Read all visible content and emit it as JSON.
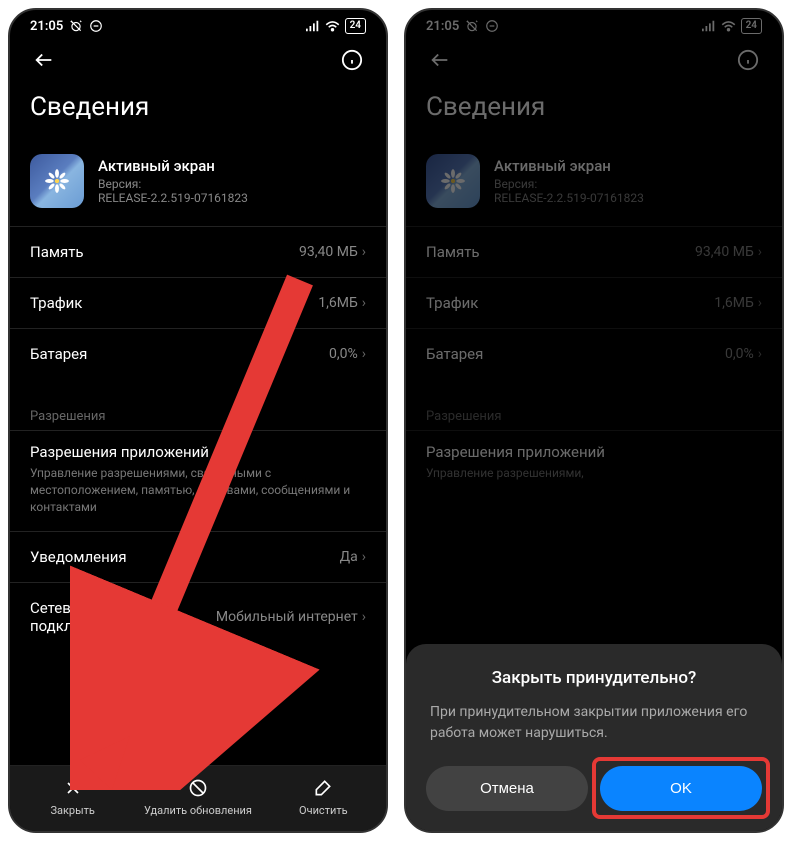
{
  "status": {
    "time": "21:05",
    "battery": "24"
  },
  "pageTitle": "Сведения",
  "app": {
    "name": "Активный экран",
    "versionLabel": "Версия:",
    "version": "RELEASE-2.2.519-07161823"
  },
  "items": {
    "memory": {
      "label": "Память",
      "value": "93,40 МБ"
    },
    "traffic": {
      "label": "Трафик",
      "value": "1,6МБ"
    },
    "battery": {
      "label": "Батарея",
      "value": "0,0%"
    }
  },
  "permissionsSection": "Разрешения",
  "permissions": {
    "title": "Разрешения приложений",
    "desc": "Управление разрешениями, связанными с местоположением, памятью, вызовами, сообщениями и контактами"
  },
  "permissionsShort": {
    "title": "Разрешения приложений",
    "desc": "Управление разрешениями,"
  },
  "notifications": {
    "label": "Уведомления",
    "value": "Да"
  },
  "network": {
    "label": "Сетевые подключения",
    "value": "Мобильный интернет"
  },
  "bottomBar": {
    "close": "Закрыть",
    "uninstall": "Удалить обновления",
    "clear": "Очистить"
  },
  "dialog": {
    "title": "Закрыть принудительно?",
    "message": "При принудительном закрытии приложения его работа может нарушиться.",
    "cancel": "Отмена",
    "ok": "OK"
  }
}
